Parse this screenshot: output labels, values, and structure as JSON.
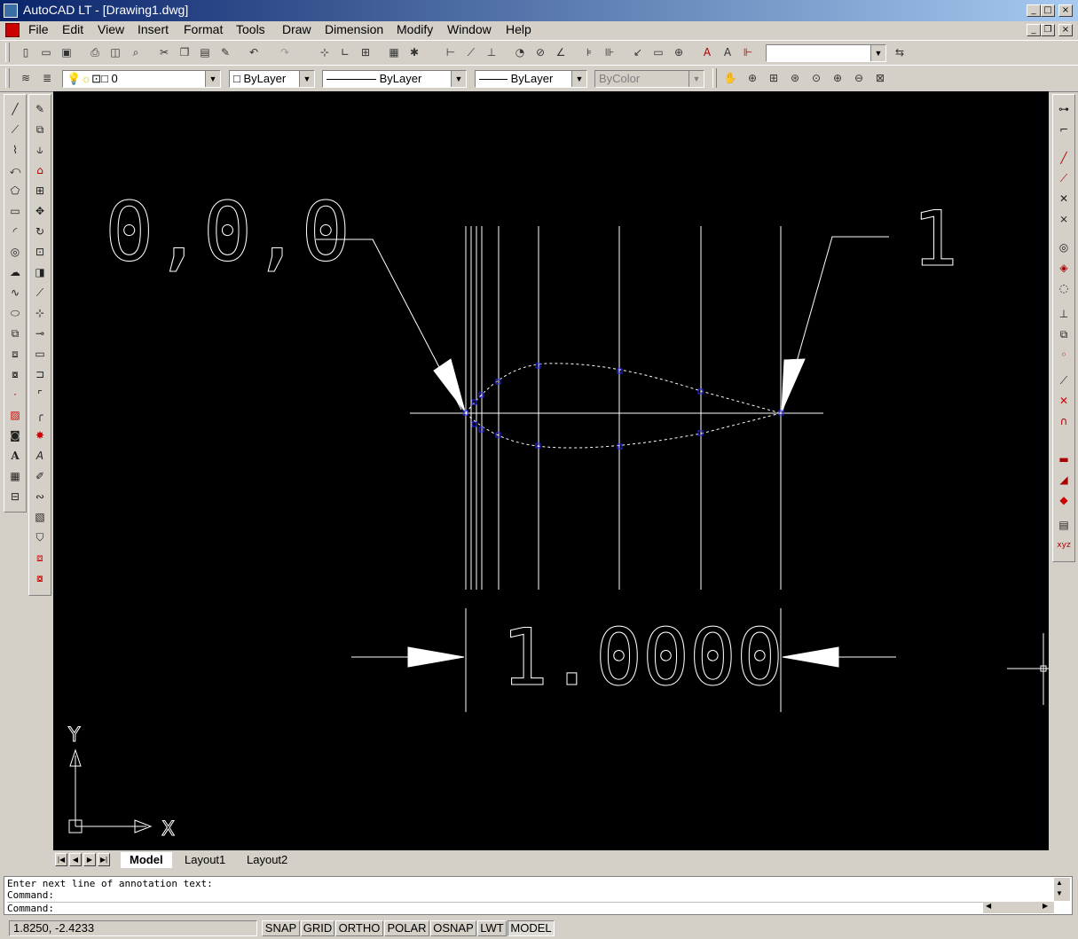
{
  "window": {
    "title": "AutoCAD LT - [Drawing1.dwg]",
    "caption_buttons": [
      "_",
      "□",
      "×"
    ],
    "mdi_buttons": [
      "_",
      "❐",
      "×"
    ]
  },
  "menu": [
    {
      "label": "File"
    },
    {
      "label": "Edit"
    },
    {
      "label": "View"
    },
    {
      "label": "Insert"
    },
    {
      "label": "Format"
    },
    {
      "label": "Tools"
    },
    {
      "label": "Draw"
    },
    {
      "label": "Dimension"
    },
    {
      "label": "Modify"
    },
    {
      "label": "Window"
    },
    {
      "label": "Help"
    }
  ],
  "properties": {
    "layer": "0",
    "color": "ByLayer",
    "linetype": "ByLayer",
    "lineweight": "ByLayer",
    "plotstyle": "ByColor"
  },
  "drawing": {
    "label_origin": "0,0,0",
    "label_end": "1",
    "dimension_text": "1.0000",
    "ucs_y": "Y",
    "ucs_x": "X"
  },
  "tabs": [
    {
      "label": "Model",
      "active": true
    },
    {
      "label": "Layout1",
      "active": false
    },
    {
      "label": "Layout2",
      "active": false
    }
  ],
  "command_lines": [
    "Enter next line of annotation text:",
    "Command:",
    "Command:"
  ],
  "status": {
    "coords": "1.8250, -2.4233",
    "buttons": [
      {
        "label": "SNAP",
        "on": false
      },
      {
        "label": "GRID",
        "on": false
      },
      {
        "label": "ORTHO",
        "on": false
      },
      {
        "label": "POLAR",
        "on": false
      },
      {
        "label": "OSNAP",
        "on": false
      },
      {
        "label": "LWT",
        "on": false
      },
      {
        "label": "MODEL",
        "on": true
      }
    ]
  },
  "colors": {
    "title_start": "#0a246a",
    "title_end": "#a6caf0",
    "canvas_bg": "#000000",
    "chrome": "#d4d0c8",
    "vertex": "#2a2aff"
  }
}
